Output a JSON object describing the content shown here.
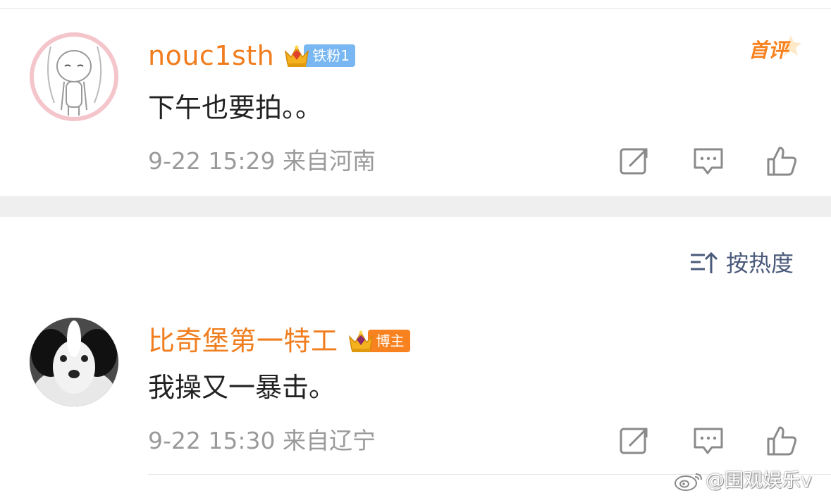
{
  "comments": [
    {
      "username": "nouc1sth",
      "badge": "铁粉1",
      "text": "下午也要拍。。",
      "meta": "9-22 15:29 来自河南",
      "first_label": "首评"
    },
    {
      "username": "比奇堡第一特工",
      "badge": "博主",
      "text": "我操又一暴击。",
      "meta": "9-22 15:30 来自辽宁"
    }
  ],
  "sort": {
    "label": "按热度"
  },
  "watermark": {
    "text": "@围观娱乐v"
  },
  "colors": {
    "username": "#f07d1e",
    "fan_badge": "#78b7f1",
    "author_badge": "#f7821f",
    "meta": "#9a9a9a",
    "sort": "#4a5a7a",
    "separator": "#efefef"
  },
  "icons": [
    "share-icon",
    "comment-icon",
    "like-icon",
    "sort-icon",
    "crown-icon",
    "weibo-logo-icon"
  ]
}
